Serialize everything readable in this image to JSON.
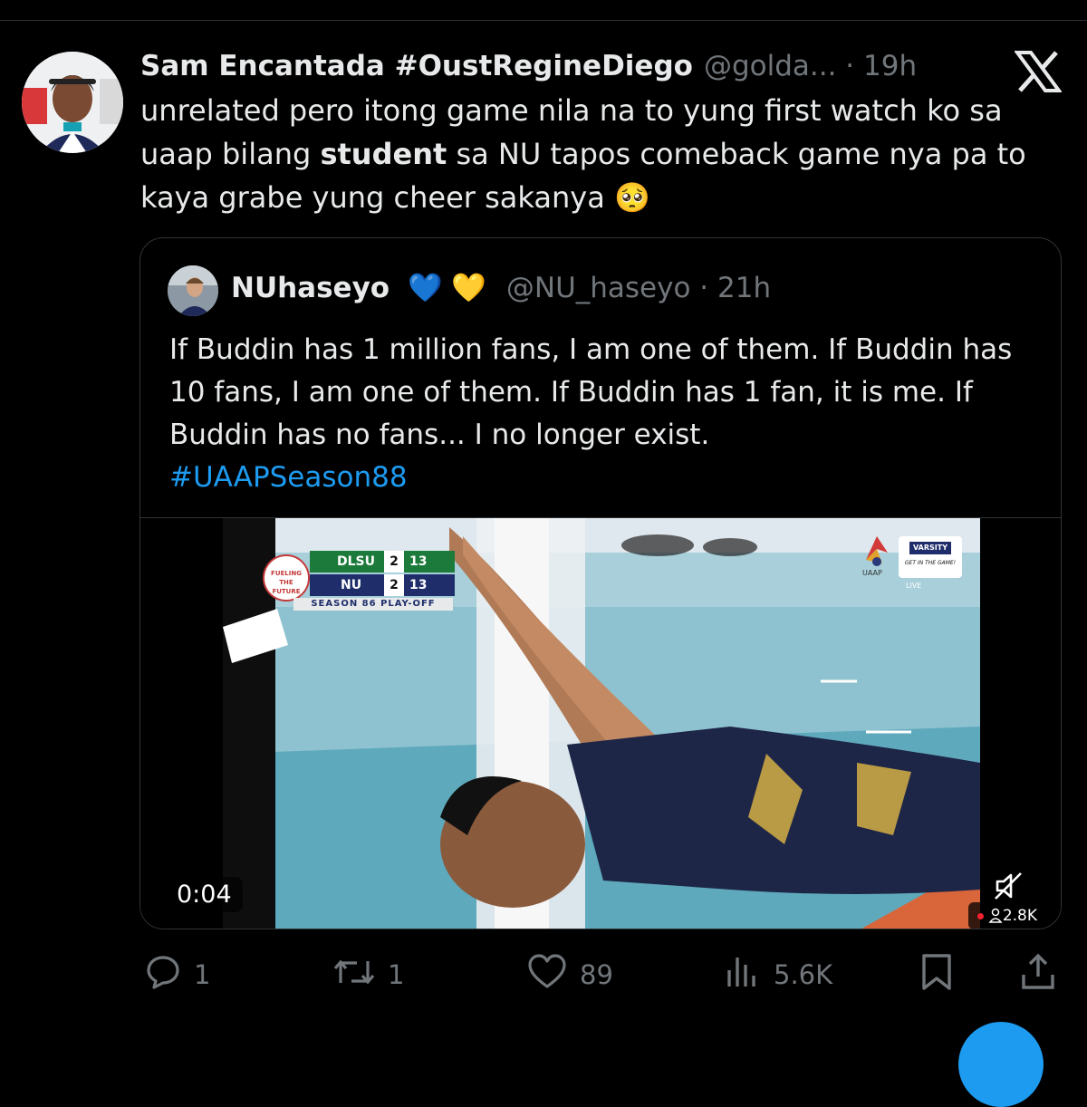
{
  "tweet": {
    "author_name": "Sam Encantada #OustRegineDiego",
    "handle": "@golda...",
    "separator": "·",
    "time": "19h",
    "text_before": "unrelated pero itong game nila na to yung first watch ko sa uaap bilang ",
    "text_bold": "student",
    "text_after": " sa NU tapos comeback game nya pa to kaya grabe yung cheer sakanya 🥺"
  },
  "quoted": {
    "author_name": "NUhaseyo",
    "hearts": "💙 💛",
    "handle": "@NU_haseyo",
    "separator": "·",
    "time": "21h",
    "text": "If Buddin has 1 million fans, I am one of them. If Buddin has 10 fans, I am one of them. If Buddin has 1 fan, it is me. If Buddin has no fans... I no longer exist.",
    "hashtag": "#UAAPSeason88",
    "video": {
      "timestamp": "0:04",
      "viewers": "2.8K",
      "scorebug": {
        "team1": "DLSU",
        "team1_sets": "2",
        "team1_points": "13",
        "team2": "NU",
        "team2_sets": "2",
        "team2_points": "13",
        "banner": "SEASON 86 PLAY-OFF",
        "sponsor": "FUELING THE FUTURE"
      },
      "broadcaster": {
        "brand": "VARSITY",
        "tagline": "GET IN THE GAME!",
        "league": "UAAP",
        "live": "LIVE"
      }
    }
  },
  "actions": {
    "replies": "1",
    "retweets": "1",
    "likes": "89",
    "views": "5.6K"
  },
  "colors": {
    "accent": "#1d9bf0",
    "muted": "#71767b",
    "text": "#e7e9ea",
    "background": "#000000"
  }
}
